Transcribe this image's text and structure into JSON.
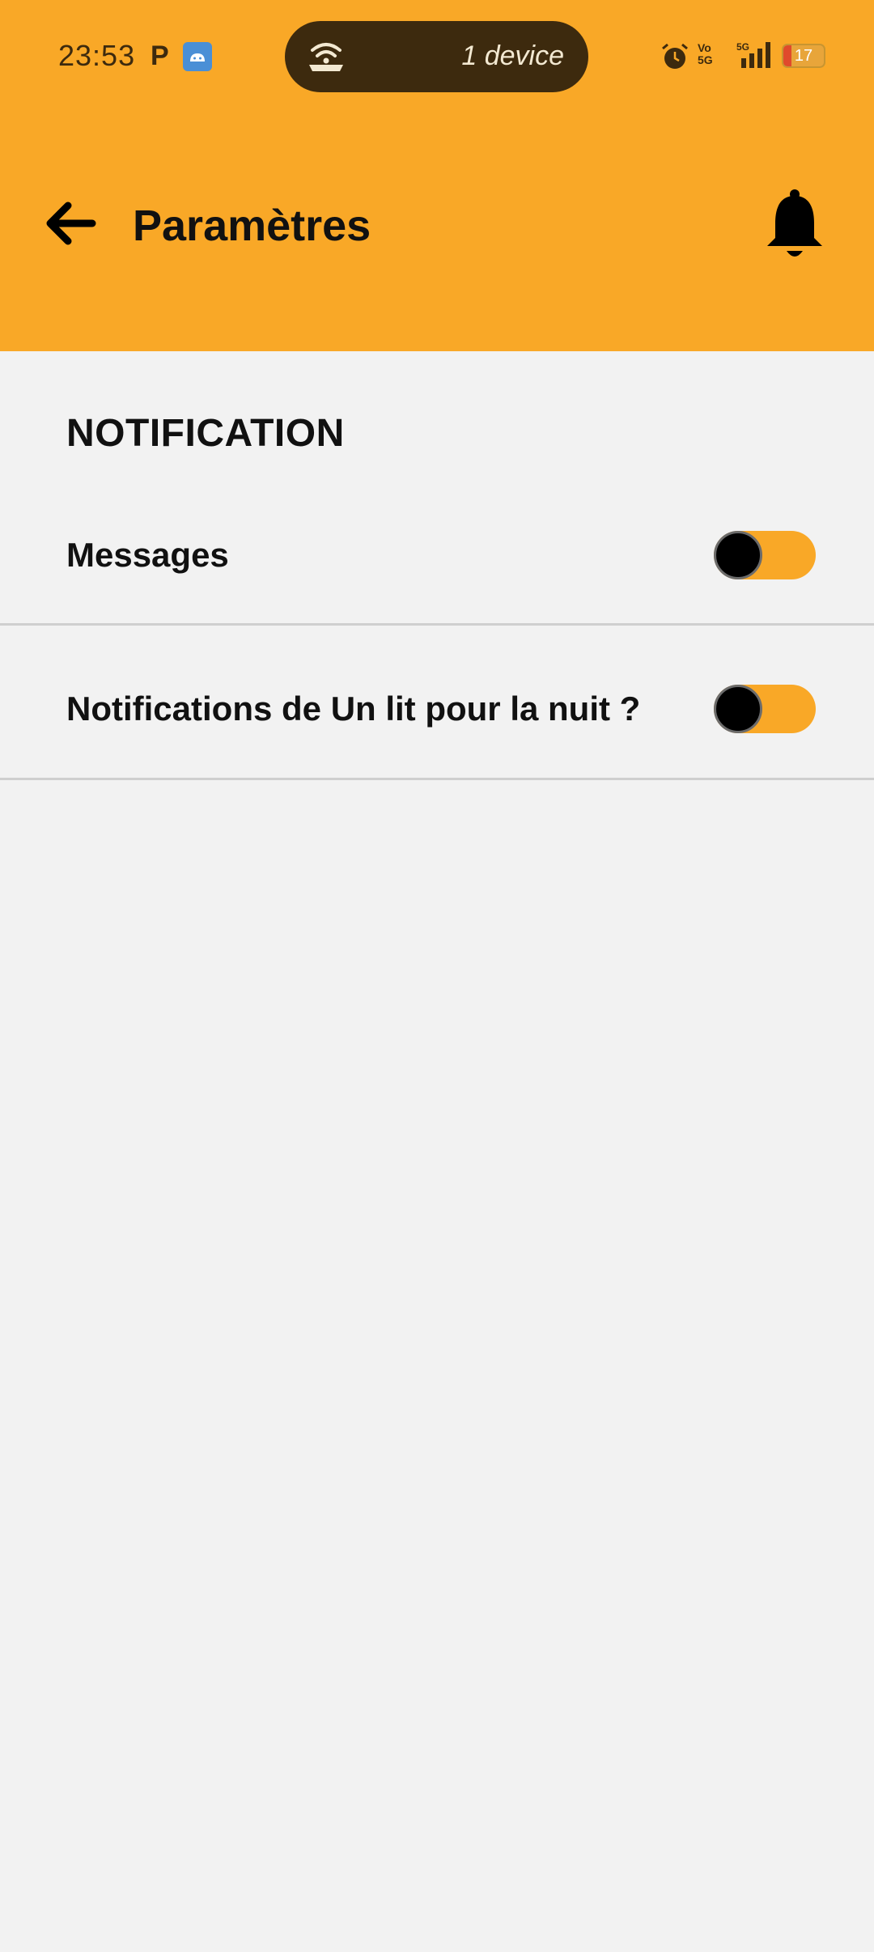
{
  "status_bar": {
    "time": "23:53",
    "p_glyph": "P",
    "hotspot_devices": "1 device",
    "vo_line1": "Vo",
    "vo_line2": "5G",
    "signal_label": "5G",
    "battery": "17",
    "icons": [
      "parking-icon",
      "android-icon",
      "hotspot-icon",
      "alarm-icon",
      "signal-icon",
      "battery-icon"
    ]
  },
  "app_bar": {
    "title": "Paramètres",
    "back_icon": "arrow-left-icon",
    "bell_icon": "bell-icon",
    "background": "#f9a827"
  },
  "section": {
    "title": "NOTIFICATION"
  },
  "settings": [
    {
      "label": "Messages",
      "enabled": false
    },
    {
      "label": "Notifications de Un lit pour la nuit ?",
      "enabled": false
    }
  ],
  "colors": {
    "accent": "#f9a827",
    "background": "#f2f2f2",
    "text": "#111111",
    "divider": "#cfcfcf"
  }
}
